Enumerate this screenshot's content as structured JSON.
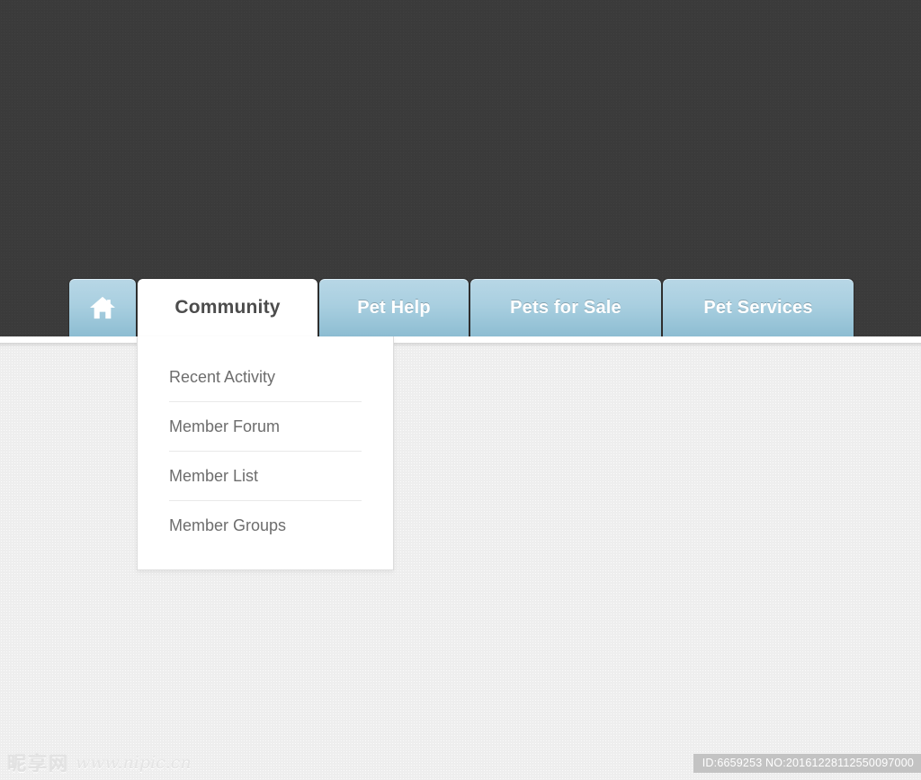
{
  "site": {
    "background_dark": "#3b3b3b",
    "background_light": "#eeeeee",
    "tab_accent": "#a9cfe0"
  },
  "nav": {
    "home": {
      "icon": "home-icon",
      "label": ""
    },
    "tabs": [
      {
        "label": "Community",
        "state": "active"
      },
      {
        "label": "Pet Help",
        "state": "default"
      },
      {
        "label": "Pets for Sale",
        "state": "default"
      },
      {
        "label": "Pet Services",
        "state": "default"
      }
    ]
  },
  "dropdown": {
    "parent": "Community",
    "items": [
      {
        "label": "Recent Activity"
      },
      {
        "label": "Member Forum"
      },
      {
        "label": "Member List"
      },
      {
        "label": "Member Groups"
      }
    ]
  },
  "watermark": {
    "brand_cn": "昵享网",
    "url": "www.nipic.cn",
    "id_text": "ID:6659253 NO:20161228112550097000"
  }
}
